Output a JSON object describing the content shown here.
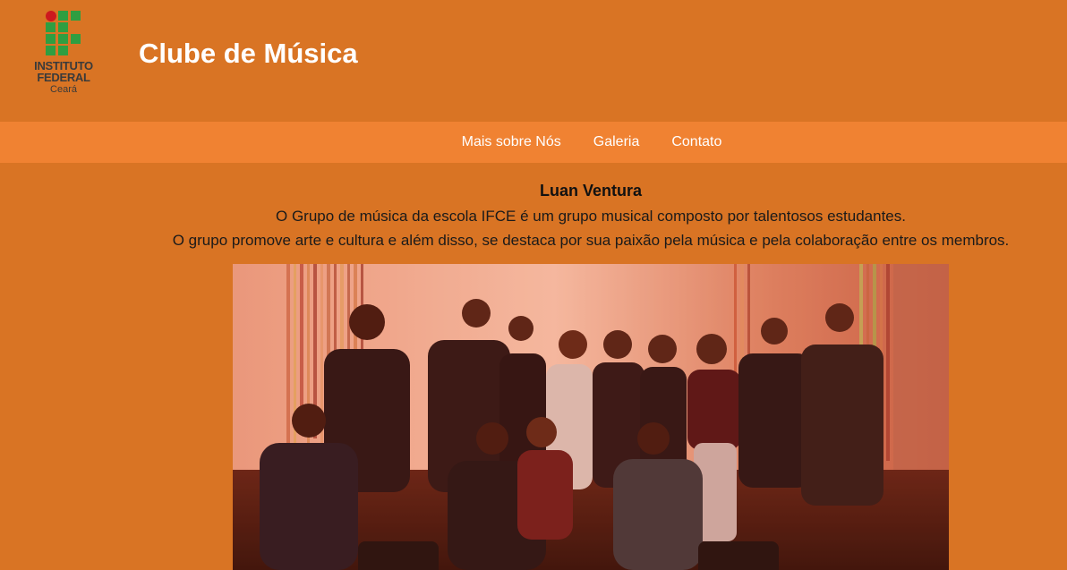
{
  "logo": {
    "line1": "INSTITUTO",
    "line2": "FEDERAL",
    "line3": "Ceará",
    "colors": {
      "dot": "#cd191e",
      "squares": "#2f9e41"
    }
  },
  "header": {
    "title": "Clube de Música"
  },
  "nav": {
    "items": [
      {
        "label": "Mais sobre Nós"
      },
      {
        "label": "Galeria"
      },
      {
        "label": "Contato"
      }
    ]
  },
  "main": {
    "author": "Luan Ventura",
    "paragraph1": "O Grupo de música da escola IFCE é um grupo musical composto por talentosos estudantes.",
    "paragraph2": "O grupo promove arte e cultura e além disso, se destaca por sua paixão pela música e pela colaboração entre os membros."
  },
  "colors": {
    "page_bg": "#d97424",
    "nav_bg": "#f08232",
    "title_text": "#ffffff"
  }
}
